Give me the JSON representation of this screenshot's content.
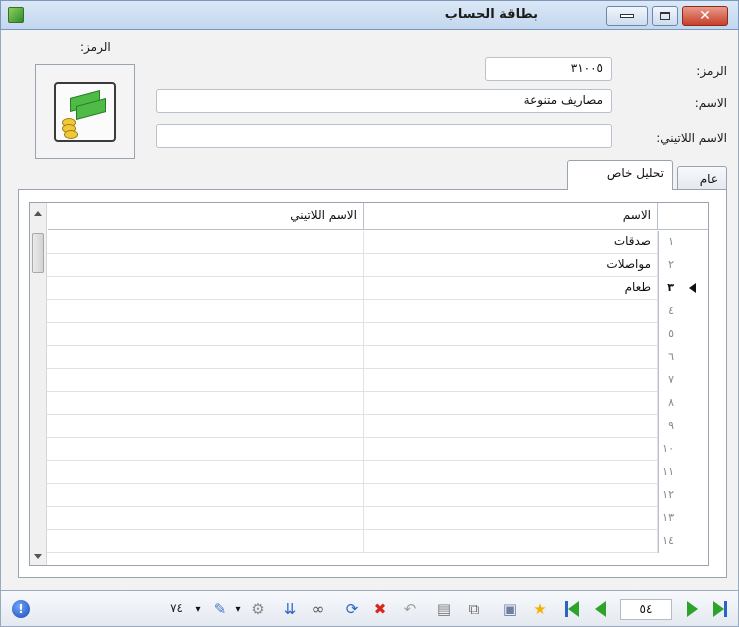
{
  "window": {
    "title": "بطاقة الحساب",
    "close_glyph": "✕"
  },
  "form": {
    "code_label": "الرمز:",
    "code_value": "٣١٠٠٥",
    "name_label": "الاسم:",
    "name_value": "مصاريف متنوعة",
    "latin_label": "الاسم اللاتيني:",
    "latin_value": "",
    "icon_label": "الرمز:"
  },
  "tabs": [
    {
      "label": "عام",
      "active": false
    },
    {
      "label": "تحليل خاص",
      "active": true
    }
  ],
  "grid": {
    "columns": [
      "الاسم",
      "الاسم اللاتيني"
    ],
    "rows": [
      {
        "num": "١",
        "name": "صدقات",
        "latin": "",
        "current": false
      },
      {
        "num": "٢",
        "name": "مواصلات",
        "latin": "",
        "current": false
      },
      {
        "num": "٣",
        "name": "طعام",
        "latin": "",
        "current": true
      },
      {
        "num": "٤",
        "name": "",
        "latin": "",
        "current": false
      },
      {
        "num": "٥",
        "name": "",
        "latin": "",
        "current": false
      },
      {
        "num": "٦",
        "name": "",
        "latin": "",
        "current": false
      },
      {
        "num": "٧",
        "name": "",
        "latin": "",
        "current": false
      },
      {
        "num": "٨",
        "name": "",
        "latin": "",
        "current": false
      },
      {
        "num": "٩",
        "name": "",
        "latin": "",
        "current": false
      },
      {
        "num": "١٠",
        "name": "",
        "latin": "",
        "current": false
      },
      {
        "num": "١١",
        "name": "",
        "latin": "",
        "current": false
      },
      {
        "num": "١٢",
        "name": "",
        "latin": "",
        "current": false
      },
      {
        "num": "١٣",
        "name": "",
        "latin": "",
        "current": false
      },
      {
        "num": "١٤",
        "name": "",
        "latin": "",
        "current": false
      }
    ]
  },
  "toolbar": {
    "record_number": "٥٤",
    "record_count": "٧٤",
    "icons": [
      "last-record-icon",
      "next-record-icon",
      "prev-record-icon",
      "first-record-icon",
      "favorite-icon",
      "save-icon",
      "copy-icon",
      "paste-icon",
      "undo-icon",
      "delete-icon",
      "refresh-icon",
      "search-icon",
      "sort-icon",
      "options-icon",
      "attachment-icon",
      "info-icon"
    ]
  },
  "colors": {
    "nav_green": "#2da32a",
    "nav_blue": "#2a64c4",
    "delete_red": "#d8261b"
  }
}
